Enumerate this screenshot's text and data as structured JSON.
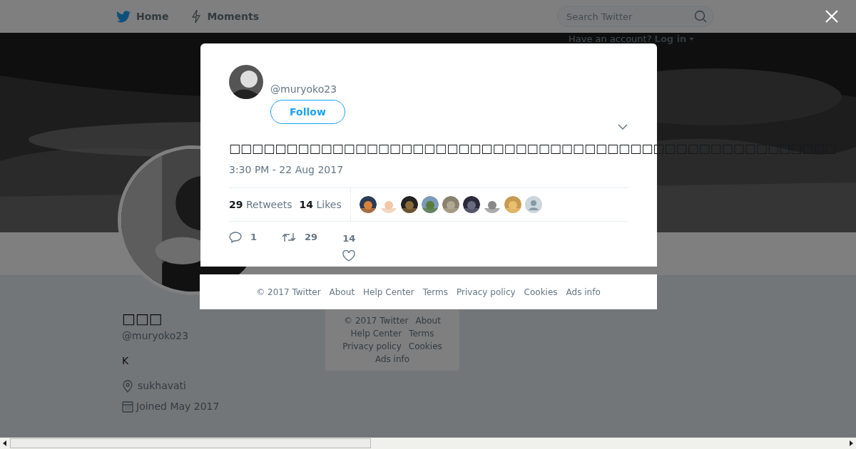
{
  "nav": {
    "items": [
      {
        "label": "Home",
        "kind": "bird"
      },
      {
        "label": "Moments",
        "kind": "bolt"
      }
    ],
    "search": {
      "placeholder": "Search Twitter"
    },
    "account_prompt": "Have an account?",
    "login": "Log in"
  },
  "banner": {
    "kind": "picture"
  },
  "profile": {
    "name": "□□□",
    "handle": "@muryoko23",
    "bio": "K",
    "location": "sukhavati",
    "joined": "Joined May 2017"
  },
  "page_footer": [
    "© 2017 Twitter",
    "About",
    "Help Center",
    "Terms",
    "Privacy policy",
    "Cookies",
    "Ads info"
  ],
  "modal": {
    "handle": "@muryoko23",
    "follow": "Follow",
    "text": "□□□□□□□□□□□□□□□□□□□□□□□□□□□□□□□□□□□□□□□□□□□□□□□□□□□□□",
    "time": "3:30 PM - 22 Aug 2017",
    "stats": [
      {
        "count": "29",
        "label": "Retweets"
      },
      {
        "count": "14",
        "label": "Likes"
      }
    ],
    "likers": [
      {
        "kind": "picture"
      },
      {
        "kind": "picture"
      },
      {
        "kind": "picture"
      },
      {
        "kind": "picture"
      },
      {
        "kind": "picture"
      },
      {
        "kind": "picture"
      },
      {
        "kind": "picture"
      },
      {
        "kind": "picture"
      },
      {
        "kind": "default"
      }
    ],
    "actions": [
      {
        "kind": "reply",
        "count": "1"
      },
      {
        "kind": "retweet",
        "count": "29"
      },
      {
        "kind": "like",
        "count": "14"
      }
    ]
  },
  "modal_footer": [
    "© 2017 Twitter",
    "About",
    "Help Center",
    "Terms",
    "Privacy policy",
    "Cookies",
    "Ads info"
  ]
}
